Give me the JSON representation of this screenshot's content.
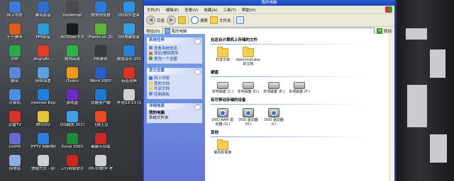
{
  "desktop": {
    "icons": [
      {
        "label": "网上邻居",
        "color": "#3b7dd8"
      },
      {
        "label": "千千静听",
        "color": "#e05a1a"
      },
      {
        "label": "DW",
        "color": "#2aa84a"
      },
      {
        "label": "翻译",
        "color": "#5a88d6"
      },
      {
        "label": "计算机",
        "color": "#4a8fe0"
      },
      {
        "label": "迅雷TV",
        "color": "#d9342b"
      },
      {
        "label": "UniHS",
        "color": "#6a6ad0"
      },
      {
        "label": "回收站",
        "color": "#88b0e0"
      },
      {
        "label": "暴风影音",
        "color": "#2f6fd0"
      },
      {
        "label": "PPS影音",
        "color": "#2c9bd6"
      },
      {
        "label": "AngryBi...",
        "color": "#e23a2b"
      },
      {
        "label": "网络设置",
        "color": "#5aa0e0"
      },
      {
        "label": "Internet Explorer",
        "color": "#1f7fe0"
      },
      {
        "label": "腾讯QQ",
        "color": "#e5c33a"
      },
      {
        "label": "PPTV 网络电视",
        "color": "#2a7fd8"
      },
      {
        "label": "快捷方式 - 运行",
        "color": "#cfcfcf"
      },
      {
        "label": "routemap",
        "color": "#4b4b4b"
      },
      {
        "label": "ACDSee 5.0",
        "color": "#1a1a1a"
      },
      {
        "label": "搜狗高速",
        "color": "#2fb24a"
      },
      {
        "label": "iTudou",
        "color": "#f29a1a"
      },
      {
        "label": "游戏盒",
        "color": "#6f2cc4"
      },
      {
        "label": "QQ截图 20130717...",
        "color": "#3fa3e0"
      },
      {
        "label": "Excel 2003",
        "color": "#1f8a3a"
      },
      {
        "label": "工行网银助手",
        "color": "#c8281e"
      },
      {
        "label": "搜狗浏览器",
        "color": "#2e7ad6"
      },
      {
        "label": "Plants vs. Zombie...",
        "color": "#5db43a"
      },
      {
        "label": "HK游戏",
        "color": "#3a3a3a"
      },
      {
        "label": "Word 2003",
        "color": "#2b5fc8"
      },
      {
        "label": "优酷客户端",
        "color": "#1e7ad0"
      },
      {
        "label": "飞速土豆",
        "color": "#e64a2a"
      },
      {
        "label": "毒霸专业版",
        "color": "#c72b2b"
      },
      {
        "label": "08-10数学 考生号",
        "color": "#cfcfcf"
      },
      {
        "label": "QQ软件管家",
        "color": "#2f8fe0"
      },
      {
        "label": "QQ电脑管家",
        "color": "#35a0e0"
      },
      {
        "label": "酷我音乐 2012",
        "color": "#2a7fd8"
      },
      {
        "label": "有道词典",
        "color": "#d9342b"
      },
      {
        "label": "外语12-13 (1) 学期",
        "color": "#cfcfcf"
      }
    ]
  },
  "window": {
    "title": "我的电脑",
    "menu": [
      "文件(F)",
      "编辑(E)",
      "查看(V)",
      "收藏(A)",
      "工具(T)",
      "帮助(H)"
    ],
    "toolbar": {
      "back": "后退",
      "forward_icon": "forward-icon",
      "up_icon": "up-icon",
      "search": "搜索",
      "folders": "文件夹"
    },
    "address": {
      "label": "地址(D)",
      "value": "我的电脑",
      "go": "转到"
    },
    "tasks": {
      "system": {
        "title": "系统任务",
        "items": [
          "查看系统信息",
          "添加/删除程序",
          "更改一个设置"
        ]
      },
      "other": {
        "title": "其它位置",
        "items": [
          "网上邻居",
          "我的文档",
          "共享文档",
          "控制面板"
        ]
      },
      "details": {
        "title": "详细信息",
        "name": "我的电脑",
        "desc": "系统文件夹"
      }
    },
    "sections": {
      "stored": {
        "title": "在这台计算机上存储的文件",
        "items": [
          {
            "label": "共享文档"
          },
          {
            "label": "Administrator 的文档"
          }
        ]
      },
      "hdd": {
        "title": "硬盘",
        "items": [
          {
            "label": "本地磁盘 (C:)"
          },
          {
            "label": "本地磁盘 (D:)"
          },
          {
            "label": "本地磁盘 (E:)"
          },
          {
            "label": "本地磁盘 (F:)"
          }
        ]
      },
      "removable": {
        "title": "有可移动存储的设备",
        "items": [
          {
            "label": "DVD-RAM 驱动器 (G:)"
          },
          {
            "label": "DVD 驱动器 (H:)"
          },
          {
            "label": "DVD 驱动器 (I:)"
          }
        ]
      },
      "other": {
        "title": "其他",
        "items": [
          {
            "label": "暴风影视库"
          }
        ]
      }
    }
  }
}
